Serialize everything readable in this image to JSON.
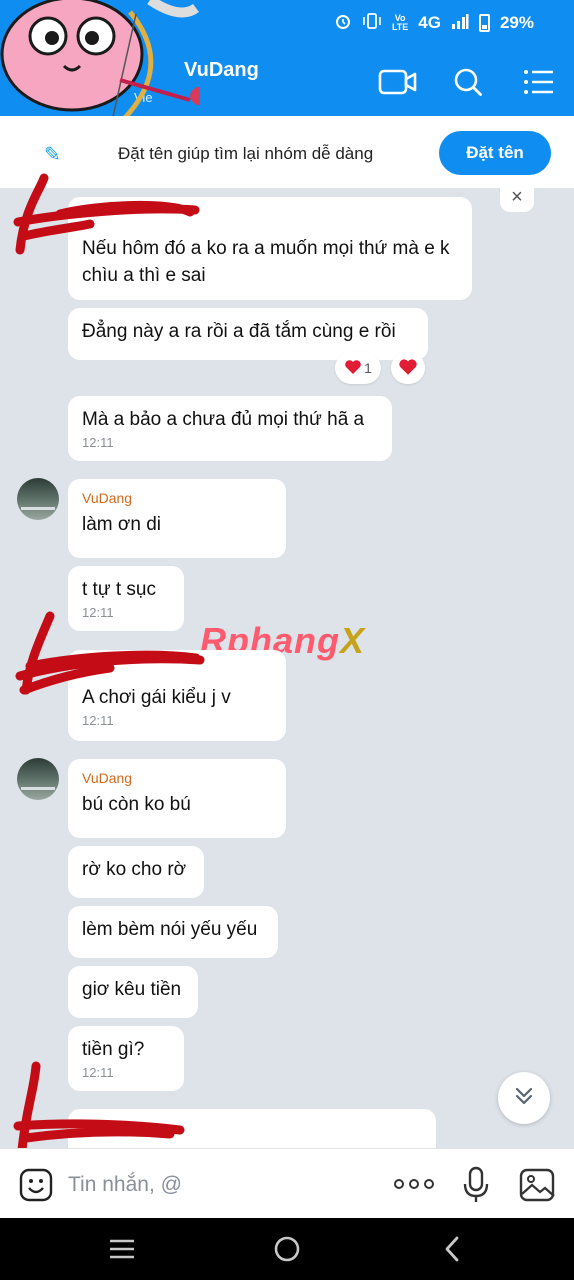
{
  "status_bar": {
    "network": "4G",
    "battery": "29%",
    "icons": [
      "alarm-icon",
      "vibrate-icon",
      "volte-icon",
      "signal-icon",
      "battery-icon"
    ]
  },
  "header": {
    "title": "VuDang",
    "subtitle": "Vie",
    "icons": [
      "video-call-icon",
      "search-icon",
      "menu-icon"
    ]
  },
  "banner": {
    "text": "Đặt tên giúp tìm lại nhóm dễ dàng",
    "button_label": "Đặt tên",
    "close_glyph": "×"
  },
  "messages": [
    {
      "text": "Nếu hôm đó a ko ra a muốn mọi thứ mà e k chìu a thì e sai",
      "time": ""
    },
    {
      "text": "Đẳng này a ra rồi  a đã tắm cùng e rồi",
      "time": "",
      "reactions": [
        {
          "icon": "heart-icon",
          "count": "1"
        },
        {
          "icon": "heart-icon",
          "count": ""
        }
      ]
    },
    {
      "text": "Mà a bảo a chưa đủ mọi thứ hã a",
      "time": "12:11"
    },
    {
      "sender": "VuDang",
      "text": "làm ơn di",
      "time": ""
    },
    {
      "text": "t tự t sục",
      "time": "12:11"
    },
    {
      "text": "A chơi gái kiểu j v",
      "time": "12:11"
    },
    {
      "sender": "VuDang",
      "text": "bú còn ko bú",
      "time": ""
    },
    {
      "text": "rờ ko cho rờ",
      "time": ""
    },
    {
      "text": "lèm bèm nói yếu yếu",
      "time": ""
    },
    {
      "text": "giơ kêu tiền",
      "time": ""
    },
    {
      "text": "tiền gì?",
      "time": "12:11"
    }
  ],
  "watermark": {
    "part1": "Rphang",
    "part2": "X"
  },
  "input": {
    "placeholder": "Tin nhắn, @",
    "icons": [
      "sticker-icon",
      "more-icon",
      "microphone-icon",
      "image-icon"
    ]
  },
  "nav": {
    "icons": [
      "recent-apps-icon",
      "home-icon",
      "back-icon"
    ]
  },
  "colors": {
    "header": "#0f8df0",
    "chat_background": "#dde3e9",
    "sender_name": "#d06a1a",
    "redaction": "#c40c17"
  }
}
